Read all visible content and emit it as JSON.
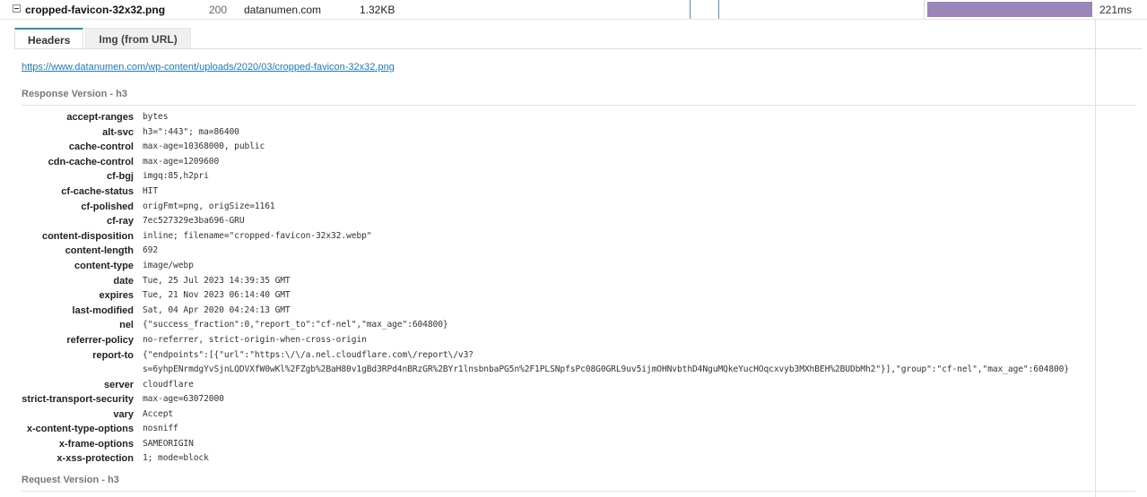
{
  "request": {
    "filename": "cropped-favicon-32x32.png",
    "status": "200",
    "domain": "datanumen.com",
    "size": "1.32KB",
    "time": "221ms"
  },
  "tabs": [
    {
      "label": "Headers",
      "active": true
    },
    {
      "label": "Img (from URL)",
      "active": false
    }
  ],
  "url": "https://www.datanumen.com/wp-content/uploads/2020/03/cropped-favicon-32x32.png",
  "response_title": "Response Version - h3",
  "request_title": "Request Version - h3",
  "headers": [
    {
      "key": "accept-ranges",
      "value": "bytes"
    },
    {
      "key": "alt-svc",
      "value": "h3=\":443\"; ma=86400"
    },
    {
      "key": "cache-control",
      "value": "max-age=10368000, public"
    },
    {
      "key": "cdn-cache-control",
      "value": "max-age=1209600"
    },
    {
      "key": "cf-bgj",
      "value": "imgq:85,h2pri"
    },
    {
      "key": "cf-cache-status",
      "value": "HIT"
    },
    {
      "key": "cf-polished",
      "value": "origFmt=png, origSize=1161"
    },
    {
      "key": "cf-ray",
      "value": "7ec527329e3ba696-GRU"
    },
    {
      "key": "content-disposition",
      "value": "inline; filename=\"cropped-favicon-32x32.webp\""
    },
    {
      "key": "content-length",
      "value": "692"
    },
    {
      "key": "content-type",
      "value": "image/webp"
    },
    {
      "key": "date",
      "value": "Tue, 25 Jul 2023 14:39:35 GMT"
    },
    {
      "key": "expires",
      "value": "Tue, 21 Nov 2023 06:14:40 GMT"
    },
    {
      "key": "last-modified",
      "value": "Sat, 04 Apr 2020 04:24:13 GMT"
    },
    {
      "key": "nel",
      "value": "{\"success_fraction\":0,\"report_to\":\"cf-nel\",\"max_age\":604800}"
    },
    {
      "key": "referrer-policy",
      "value": "no-referrer, strict-origin-when-cross-origin"
    },
    {
      "key": "report-to",
      "value": "{\"endpoints\":[{\"url\":\"https:\\/\\/a.nel.cloudflare.com\\/report\\/v3?",
      "value2": "s=6yhpENrmdgYvSjnLQDVXfW0wKl%2FZgb%2BaH80v1gBd3RPd4nBRzGR%2BYr1lnsbnbaPG5n%2F1PLSNpfsPc08G0GRL9uv5ijmOHNvbthD4NguMQkeYucHOqcxvyb3MXhBEH%2BUDbMh2\"}],\"group\":\"cf-nel\",\"max_age\":604800}"
    },
    {
      "key": "server",
      "value": "cloudflare"
    },
    {
      "key": "strict-transport-security",
      "value": "max-age=63072000"
    },
    {
      "key": "vary",
      "value": "Accept"
    },
    {
      "key": "x-content-type-options",
      "value": "nosniff"
    },
    {
      "key": "x-frame-options",
      "value": "SAMEORIGIN"
    },
    {
      "key": "x-xss-protection",
      "value": "1; mode=block"
    }
  ]
}
